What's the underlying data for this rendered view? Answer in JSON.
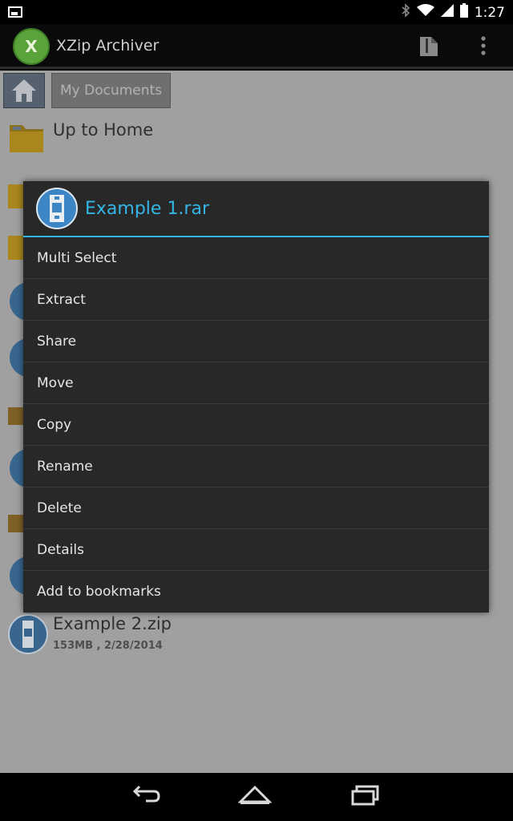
{
  "status": {
    "time": "1:27"
  },
  "app": {
    "title": "XZip Archiver",
    "logo_letter": "X"
  },
  "breadcrumb": {
    "current": "My Documents"
  },
  "files": {
    "up_home": "Up to Home",
    "example2_name": "Example 2.zip",
    "example2_meta": "153MB , 2/28/2014"
  },
  "dialog": {
    "title": "Example 1.rar",
    "items": [
      "Multi Select",
      "Extract",
      "Share",
      "Move",
      "Copy",
      "Rename",
      "Delete",
      "Details",
      "Add to bookmarks"
    ]
  },
  "colors": {
    "accent": "#33b5e5",
    "dialog_bg": "#282828",
    "logo_green": "#5aa33a"
  }
}
